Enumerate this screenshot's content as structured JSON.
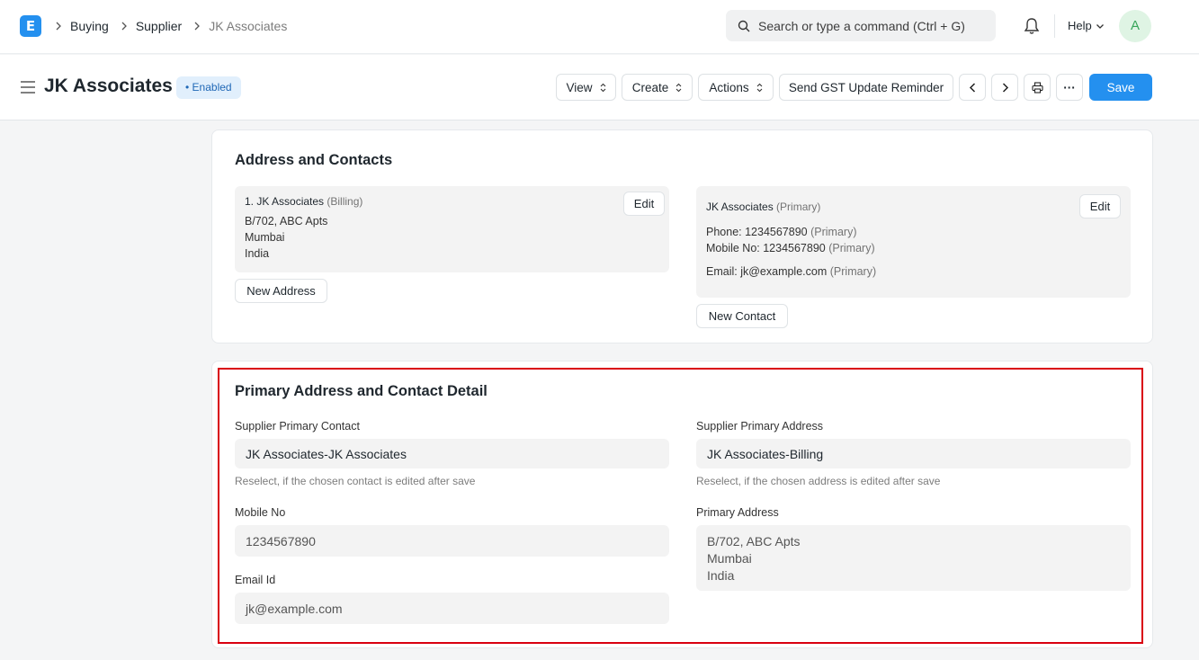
{
  "navbar": {
    "logo_letter": "E",
    "breadcrumbs": [
      "Buying",
      "Supplier",
      "JK Associates"
    ],
    "search_placeholder": "Search or type a command (Ctrl + G)",
    "help_label": "Help",
    "avatar_initial": "A"
  },
  "page": {
    "title": "JK Associates",
    "status": "Enabled",
    "buttons": {
      "view": "View",
      "create": "Create",
      "actions": "Actions",
      "send_gst": "Send GST Update Reminder",
      "more": "···",
      "save": "Save"
    }
  },
  "address_contacts": {
    "title": "Address and Contacts",
    "address": {
      "name": "1. JK Associates",
      "type": "(Billing)",
      "lines": [
        "B/702, ABC Apts",
        "Mumbai",
        "India"
      ],
      "edit": "Edit",
      "new_button": "New Address"
    },
    "contact": {
      "name": "JK Associates",
      "type": "(Primary)",
      "phone": "Phone: 1234567890",
      "phone_tag": "(Primary)",
      "mobile": "Mobile No: 1234567890",
      "mobile_tag": "(Primary)",
      "email": "Email: jk@example.com",
      "email_tag": "(Primary)",
      "edit": "Edit",
      "new_button": "New Contact"
    }
  },
  "primary_detail": {
    "title": "Primary Address and Contact Detail",
    "supplier_primary_contact_label": "Supplier Primary Contact",
    "supplier_primary_contact_value": "JK Associates-JK Associates",
    "contact_hint": "Reselect, if the chosen contact is edited after save",
    "mobile_label": "Mobile No",
    "mobile_value": "1234567890",
    "email_label": "Email Id",
    "email_value": "jk@example.com",
    "supplier_primary_address_label": "Supplier Primary Address",
    "supplier_primary_address_value": "JK Associates-Billing",
    "address_hint": "Reselect, if the chosen address is edited after save",
    "primary_address_label": "Primary Address",
    "primary_address_lines": [
      "B/702, ABC Apts",
      "Mumbai",
      "India"
    ]
  },
  "colors": {
    "accent": "#2490ef",
    "highlight": "#d9000f",
    "badge_bg": "#e1effc"
  }
}
